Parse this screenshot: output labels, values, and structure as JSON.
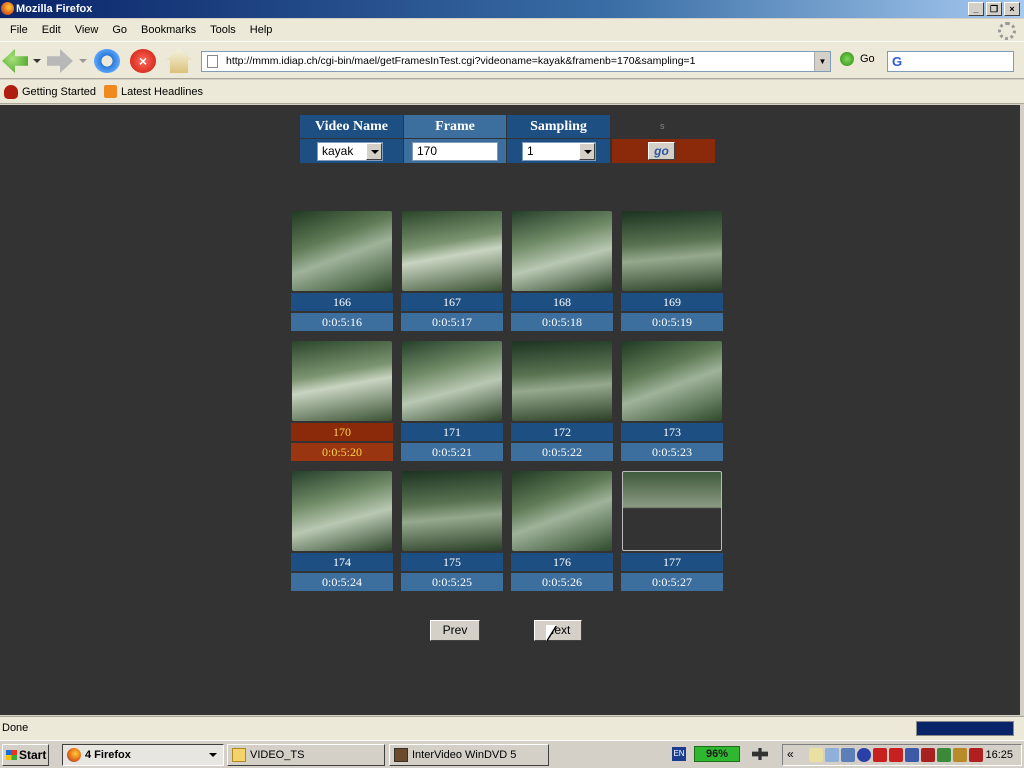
{
  "window": {
    "title": "Mozilla Firefox",
    "controls": [
      "_",
      "❐",
      "×"
    ]
  },
  "menu": [
    "File",
    "Edit",
    "View",
    "Go",
    "Bookmarks",
    "Tools",
    "Help"
  ],
  "nav": {
    "url": "http://mmm.idiap.ch/cgi-bin/mael/getFramesInTest.cgi?videoname=kayak&framenb=170&sampling=1",
    "go_label": "Go"
  },
  "bookmarks": [
    "Getting Started",
    "Latest Headlines"
  ],
  "controls": {
    "headers": {
      "video_name": "Video Name",
      "frame": "Frame",
      "sampling": "Sampling",
      "extra": "s"
    },
    "video_name_value": "kayak",
    "frame_value": "170",
    "sampling_value": "1",
    "go_label": "go"
  },
  "frames": [
    {
      "num": "166",
      "time": "0:0:5:16",
      "selected": false
    },
    {
      "num": "167",
      "time": "0:0:5:17",
      "selected": false
    },
    {
      "num": "168",
      "time": "0:0:5:18",
      "selected": false
    },
    {
      "num": "169",
      "time": "0:0:5:19",
      "selected": false
    },
    {
      "num": "170",
      "time": "0:0:5:20",
      "selected": true
    },
    {
      "num": "171",
      "time": "0:0:5:21",
      "selected": false
    },
    {
      "num": "172",
      "time": "0:0:5:22",
      "selected": false
    },
    {
      "num": "173",
      "time": "0:0:5:23",
      "selected": false
    },
    {
      "num": "174",
      "time": "0:0:5:24",
      "selected": false
    },
    {
      "num": "175",
      "time": "0:0:5:25",
      "selected": false
    },
    {
      "num": "176",
      "time": "0:0:5:26",
      "selected": false
    },
    {
      "num": "177",
      "time": "0:0:5:27",
      "selected": false
    }
  ],
  "pager": {
    "prev": "Prev",
    "next": "Next"
  },
  "status": {
    "text": "Done"
  },
  "taskbar": {
    "start": "Start",
    "tasks": [
      "4 Firefox",
      "VIDEO_TS",
      "InterVideo WinDVD 5"
    ],
    "language": "EN",
    "battery": "96%",
    "clock": "16:25"
  },
  "colors": {
    "header": "#1d4f82",
    "header_alt": "#3d6f9e",
    "selected": "#8a2a0a",
    "selected_text": "#ffd24a",
    "page_bg": "#333333"
  }
}
